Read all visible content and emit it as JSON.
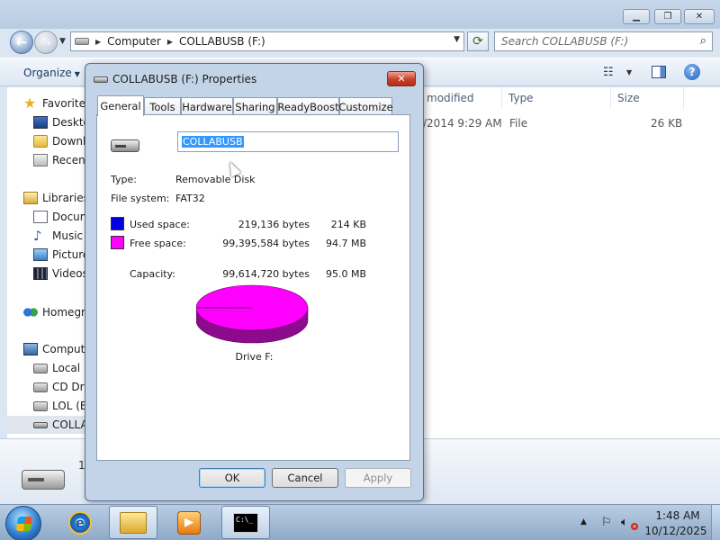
{
  "explorer": {
    "address": {
      "segments": [
        "Computer",
        "COLLABUSB (F:)"
      ]
    },
    "search_placeholder": "Search COLLABUSB (F:)",
    "toolbar": {
      "organize_label": "Organize"
    },
    "nav": {
      "favorites": "Favorites",
      "desktop": "Desktop",
      "downloads": "Downloads",
      "recent": "Recent Places",
      "libraries": "Libraries",
      "documents": "Documents",
      "music": "Music",
      "pictures": "Pictures",
      "videos": "Videos",
      "homegroup": "Homegroup",
      "computer": "Computer",
      "local_disk": "Local Disk",
      "cd_drive": "CD Drive",
      "lol": "LOL (E:)",
      "collab": "COLLABUSB (F:)"
    },
    "columns": {
      "modified": "modified",
      "type": "Type",
      "size": "Size"
    },
    "file": {
      "modified": "/2014 9:29 AM",
      "type": "File",
      "size": "26 KB"
    },
    "details": {
      "count": "1"
    }
  },
  "dialog": {
    "title": "COLLABUSB (F:) Properties",
    "tabs": [
      "General",
      "Tools",
      "Hardware",
      "Sharing",
      "ReadyBoost",
      "Customize"
    ],
    "volume_label": "COLLABUSB",
    "type_label": "Type:",
    "type_value": "Removable Disk",
    "fs_label": "File system:",
    "fs_value": "FAT32",
    "used": {
      "label": "Used space:",
      "bytes": "219,136 bytes",
      "size": "214 KB",
      "color": "#0000e0"
    },
    "free": {
      "label": "Free space:",
      "bytes": "99,395,584 bytes",
      "size": "94.7 MB",
      "color": "#ff00ff"
    },
    "capacity": {
      "label": "Capacity:",
      "bytes": "99,614,720 bytes",
      "size": "95.0 MB"
    },
    "used_fraction": 0.0022,
    "drive_caption": "Drive F:",
    "buttons": {
      "ok": "OK",
      "cancel": "Cancel",
      "apply": "Apply"
    }
  },
  "taskbar": {
    "time": "1:48 AM",
    "date": "10/12/2025",
    "cmd_text": "C:\\_"
  },
  "icons": [
    "back-arrow-icon",
    "forward-arrow-icon",
    "refresh-icon",
    "search-icon",
    "help-icon",
    "windows-logo-icon",
    "ie-icon",
    "explorer-folder-icon",
    "media-player-icon",
    "cmd-icon",
    "usb-drive-icon"
  ]
}
